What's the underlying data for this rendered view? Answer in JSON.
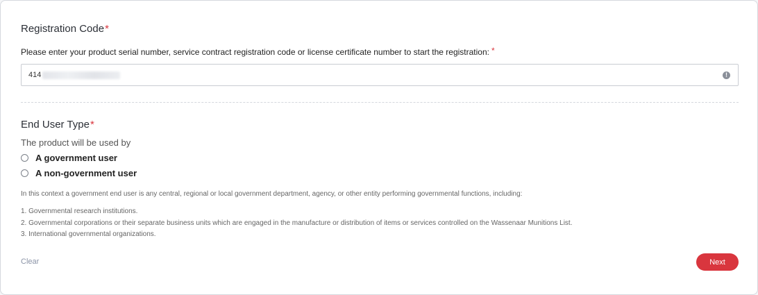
{
  "registration": {
    "title": "Registration Code",
    "required_mark": "*",
    "prompt": "Please enter your product serial number, service contract registration code or license certificate number to start the registration:",
    "prompt_required_mark": "*",
    "input_value_visible": "414",
    "warning_icon": "exclamation-circle-icon"
  },
  "end_user": {
    "title": "End User Type",
    "required_mark": "*",
    "subtitle": "The product will be used by",
    "options": [
      {
        "label": "A government user",
        "selected": false
      },
      {
        "label": "A non-government user",
        "selected": false
      }
    ],
    "intro": "In this context a government end user is any central, regional or local government department, agency, or other entity performing governmental functions, including:",
    "list": [
      "1. Governmental research institutions.",
      "2. Governmental corporations or their separate business units which are engaged in the manufacture or distribution of items or services controlled on the Wassenaar Munitions List.",
      "3. International governmental organizations."
    ]
  },
  "actions": {
    "clear_label": "Clear",
    "next_label": "Next"
  },
  "colors": {
    "accent": "#d9363e",
    "link": "#8a93a6"
  }
}
